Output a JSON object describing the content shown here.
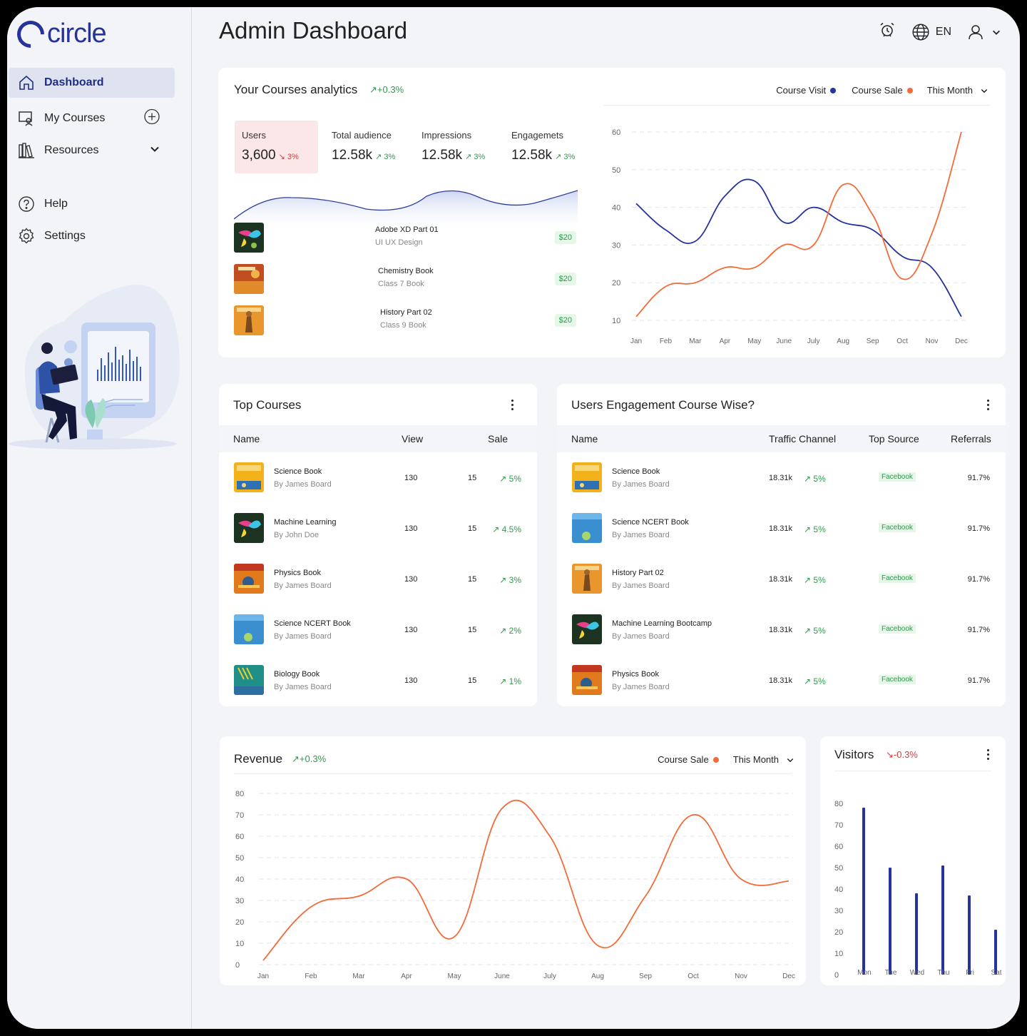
{
  "app": {
    "logo_text": "circle",
    "page_title": "Admin Dashboard",
    "language": "EN"
  },
  "sidebar": {
    "items": [
      {
        "label": "Dashboard",
        "icon": "home-icon",
        "active": true
      },
      {
        "label": "My Courses",
        "icon": "courses-icon"
      },
      {
        "label": "Resources",
        "icon": "books-icon"
      },
      {
        "label": "Help",
        "icon": "help-icon"
      },
      {
        "label": "Settings",
        "icon": "gear-icon"
      }
    ]
  },
  "analytics": {
    "title": "Your Courses analytics",
    "trend": "+0.3%",
    "legend": {
      "visit": "Course Visit",
      "sale": "Course Sale",
      "period": "This Month"
    },
    "stats": [
      {
        "label": "Users",
        "value": "3,600",
        "trend": "3%",
        "dir": "down"
      },
      {
        "label": "Total audience",
        "value": "12.58k",
        "trend": "3%",
        "dir": "up"
      },
      {
        "label": "Impressions",
        "value": "12.58k",
        "trend": "3%",
        "dir": "up"
      },
      {
        "label": "Engagemets",
        "value": "12.58k",
        "trend": "3%",
        "dir": "up"
      }
    ],
    "courses": [
      {
        "name": "Adobe XD Part 01",
        "sub": "UI UX Design",
        "price": "$20"
      },
      {
        "name": "Chemistry Book",
        "sub": "Class 7 Book",
        "price": "$20"
      },
      {
        "name": "History Part 02",
        "sub": "Class 9 Book",
        "price": "$20"
      }
    ]
  },
  "top_courses": {
    "title": "Top Courses",
    "headers": {
      "name": "Name",
      "view": "View",
      "sale": "Sale"
    },
    "rows": [
      {
        "name": "Science Book",
        "by": "By James Board",
        "view": "130",
        "sale": "15",
        "trend": "5%"
      },
      {
        "name": "Machine Learning",
        "by": "By John Doe",
        "view": "130",
        "sale": "15",
        "trend": "4.5%"
      },
      {
        "name": "Physics Book",
        "by": "By James Board",
        "view": "130",
        "sale": "15",
        "trend": "3%"
      },
      {
        "name": "Science NCERT Book",
        "by": "By James Board",
        "view": "130",
        "sale": "15",
        "trend": "2%"
      },
      {
        "name": "Biology Book",
        "by": "By James Board",
        "view": "130",
        "sale": "15",
        "trend": "1%"
      }
    ]
  },
  "engagement": {
    "title": "Users Engagement Course Wise?",
    "headers": {
      "name": "Name",
      "traffic": "Traffic Channel",
      "source": "Top Source",
      "referrals": "Referrals"
    },
    "rows": [
      {
        "name": "Science Book",
        "by": "By James Board",
        "traffic": "18.31k",
        "trend": "5%",
        "source": "Facebook",
        "referrals": "91.7%"
      },
      {
        "name": "Science NCERT Book",
        "by": "By James Board",
        "traffic": "18.31k",
        "trend": "5%",
        "source": "Facebook",
        "referrals": "91.7%"
      },
      {
        "name": "History Part 02",
        "by": "By James Board",
        "traffic": "18.31k",
        "trend": "5%",
        "source": "Facebook",
        "referrals": "91.7%"
      },
      {
        "name": "Machine Learning Bootcamp",
        "by": "By James Board",
        "traffic": "18.31k",
        "trend": "5%",
        "source": "Facebook",
        "referrals": "91.7%"
      },
      {
        "name": "Physics Book",
        "by": "By James Board",
        "traffic": "18.31k",
        "trend": "5%",
        "source": "Facebook",
        "referrals": "91.7%"
      }
    ]
  },
  "revenue": {
    "title": "Revenue",
    "trend": "+0.3%",
    "legend": "Course Sale",
    "period": "This Month"
  },
  "visitors": {
    "title": "Visitors",
    "trend": "-0.3%"
  },
  "colors": {
    "accent": "#25339a",
    "orange": "#f26b38",
    "green": "#2e9b4a",
    "red": "#e03a3a"
  },
  "chart_data": [
    {
      "type": "line",
      "categories": [
        "Jan",
        "Feb",
        "Mar",
        "Apr",
        "May",
        "June",
        "July",
        "Aug",
        "Sep",
        "Oct",
        "Nov",
        "Dec"
      ],
      "ylim": [
        10,
        60
      ],
      "yticks": [
        10,
        20,
        30,
        40,
        50,
        60
      ],
      "series": [
        {
          "name": "Course Visit",
          "values": [
            41,
            34,
            31,
            43,
            47,
            36,
            40,
            36,
            34,
            27,
            24,
            11
          ]
        },
        {
          "name": "Course Sale",
          "values": [
            11,
            19,
            20,
            24,
            24,
            30,
            30,
            46,
            38,
            21,
            33,
            60
          ]
        }
      ]
    },
    {
      "type": "line",
      "categories": [
        "Jan",
        "Feb",
        "Mar",
        "Apr",
        "May",
        "June",
        "July",
        "Aug",
        "Sep",
        "Oct",
        "Nov",
        "Dec"
      ],
      "ylim": [
        0,
        80
      ],
      "yticks": [
        0,
        10,
        20,
        30,
        40,
        50,
        60,
        70,
        80
      ],
      "series": [
        {
          "name": "Course Sale",
          "values": [
            2,
            27,
            32,
            40,
            13,
            73,
            60,
            9,
            32,
            70,
            40,
            39
          ]
        }
      ]
    },
    {
      "type": "bar",
      "categories": [
        "Mon",
        "Tue",
        "Wed",
        "Thu",
        "Fri",
        "Sat"
      ],
      "ylim": [
        0,
        80
      ],
      "yticks": [
        0,
        10,
        20,
        30,
        40,
        50,
        60,
        70,
        80
      ],
      "values": [
        78,
        50,
        38,
        51,
        37,
        21
      ]
    }
  ]
}
